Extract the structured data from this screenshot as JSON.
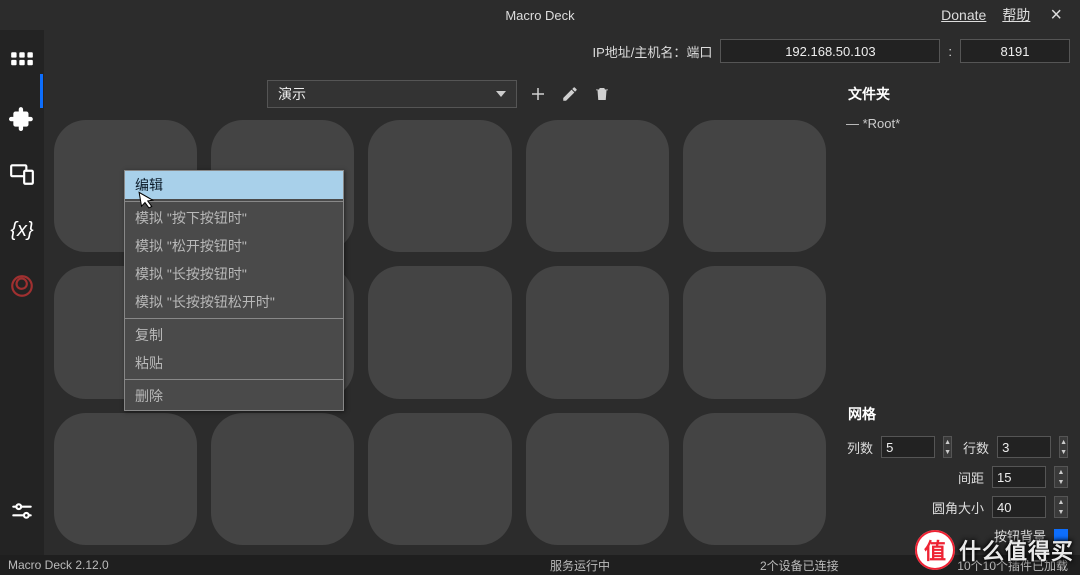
{
  "app": {
    "title": "Macro Deck",
    "donate": "Donate",
    "help": "帮助",
    "version": "Macro Deck 2.12.0"
  },
  "connection": {
    "label": "IP地址/主机名：端口",
    "ip": "192.168.50.103",
    "sep": ":",
    "port": "8191"
  },
  "profile": {
    "selected": "演示"
  },
  "right": {
    "folders_header": "文件夹",
    "root_label": "— *Root*",
    "grid_header": "网格",
    "cols_label": "列数",
    "cols": "5",
    "rows_label": "行数",
    "rows": "3",
    "gap_label": "间距",
    "gap": "15",
    "radius_label": "圆角大小",
    "radius": "40",
    "bg_label": "按钮背景"
  },
  "status": {
    "service": "服务运行中",
    "devices": "2个设备已连接",
    "plugins": "10个10个插件已加载"
  },
  "ctx": {
    "edit": "编辑",
    "sim_press": "模拟 \"按下按钮时\"",
    "sim_release": "模拟 \"松开按钮时\"",
    "sim_long": "模拟 \"长按按钮时\"",
    "sim_long_release": "模拟 \"长按按钮松开时\"",
    "copy": "复制",
    "paste": "粘贴",
    "delete": "删除"
  },
  "watermark": {
    "badge": "值",
    "text": "什么值得买"
  }
}
